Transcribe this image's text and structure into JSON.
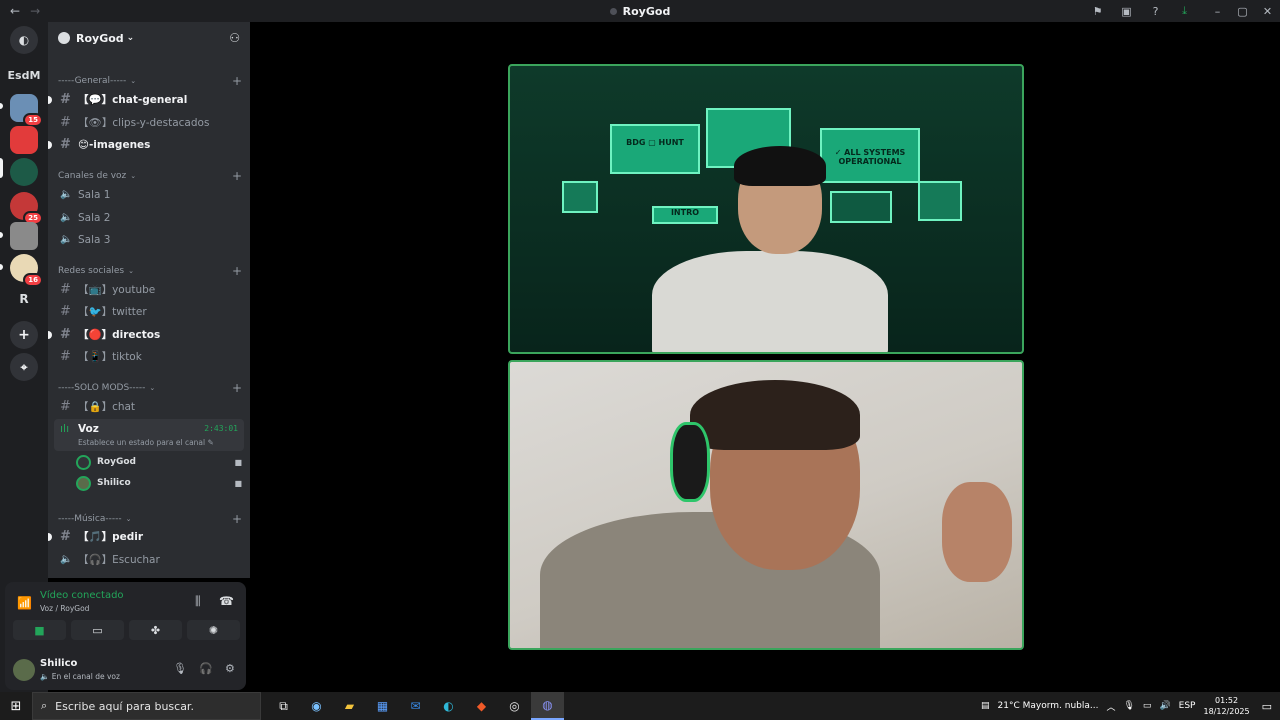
{
  "window": {
    "title": "RoyGod",
    "back": "←",
    "forward": "→"
  },
  "titlebar_icons": [
    "flag-icon",
    "screen-icon",
    "help-icon",
    "download-icon",
    "minimize-icon",
    "maximize-icon",
    "close-icon"
  ],
  "guilds": {
    "folder_label": "EsdM",
    "badges": [
      "15",
      "25",
      "16"
    ],
    "letter": "R",
    "add": "+",
    "explore": "⌖"
  },
  "server": {
    "name": "RoyGod"
  },
  "categories": {
    "general": "-----General-----",
    "voz": "Canales de voz",
    "redes": "Redes sociales",
    "mods": "-----SOLO MODS-----",
    "musica": "-----Música-----"
  },
  "channels": {
    "chat_general": "【💬】chat-general",
    "clips": "【👁】clips-y-destacados",
    "imagenes": "😊-imagenes",
    "sala1": "Sala 1",
    "sala2": "Sala 2",
    "sala3": "Sala 3",
    "youtube": "【📺】youtube",
    "twitter": "【🐦】twitter",
    "directos": "【🔴】directos",
    "tiktok": "【📱】tiktok",
    "chat": "【🔒】chat",
    "pedir": "【🎵】pedir",
    "escuchar": "【🎧】Escuchar"
  },
  "voice_channel": {
    "name": "Voz",
    "timer": "2:43:01",
    "status": "Establece un estado para el canal ✎",
    "users": [
      "RoyGod",
      "Shilico"
    ]
  },
  "connection": {
    "title": "Vídeo conectado",
    "subtitle": "Voz / RoyGod"
  },
  "user": {
    "name": "Shilico",
    "status": "🔈 En el canal de voz"
  },
  "taskbar": {
    "search_placeholder": "Escribe aquí para buscar.",
    "weather": "21°C  Mayorm. nubla...",
    "lang": "ESP",
    "time": "01:52",
    "date": "18/12/2025"
  },
  "stream": {
    "screen_bdg": "BDG ▢ HUNT",
    "screen_intro": "INTRO",
    "screen_systems": "✓ ALL SYSTEMS OPERATIONAL"
  }
}
